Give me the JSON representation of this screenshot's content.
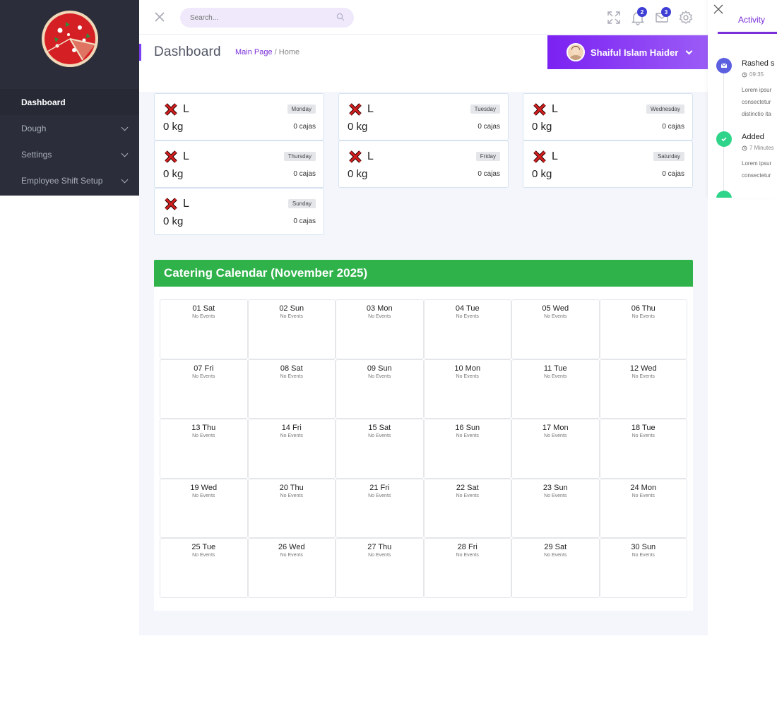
{
  "sidebar": {
    "items": [
      {
        "label": "Dashboard",
        "active": true
      },
      {
        "label": "Dough"
      },
      {
        "label": "Settings"
      },
      {
        "label": "Employee Shift Setup"
      }
    ]
  },
  "topbar": {
    "search_placeholder": "Search...",
    "notifications_count": "2",
    "messages_count": "3"
  },
  "header": {
    "title": "Dashboard",
    "breadcrumb_link": "Main Page",
    "breadcrumb_sep": "/",
    "breadcrumb_current": "Home",
    "user_name": "Shaiful Islam Haider"
  },
  "days": [
    {
      "letter": "L",
      "day": "Monday",
      "kg": "0 kg",
      "cajas": "0 cajas"
    },
    {
      "letter": "L",
      "day": "Tuesday",
      "kg": "0 kg",
      "cajas": "0 cajas"
    },
    {
      "letter": "L",
      "day": "Wednesday",
      "kg": "0 kg",
      "cajas": "0 cajas"
    },
    {
      "letter": "L",
      "day": "Thursday",
      "kg": "0 kg",
      "cajas": "0 cajas"
    },
    {
      "letter": "L",
      "day": "Friday",
      "kg": "0 kg",
      "cajas": "0 cajas"
    },
    {
      "letter": "L",
      "day": "Saturday",
      "kg": "0 kg",
      "cajas": "0 cajas"
    },
    {
      "letter": "L",
      "day": "Sunday",
      "kg": "0 kg",
      "cajas": "0 cajas"
    }
  ],
  "calendar": {
    "title": "Catering Calendar (November 2025)",
    "no_events": "No Events",
    "dates": [
      "01 Sat",
      "02 Sun",
      "03 Mon",
      "04 Tue",
      "05 Wed",
      "06 Thu",
      "07 Fri",
      "08 Sat",
      "09 Sun",
      "10 Mon",
      "11 Tue",
      "12 Wed",
      "13 Thu",
      "14 Fri",
      "15 Sat",
      "16 Sun",
      "17 Mon",
      "18 Tue",
      "19 Wed",
      "20 Thu",
      "21 Fri",
      "22 Sat",
      "23 Sun",
      "24 Mon",
      "25 Tue",
      "26 Wed",
      "27 Thu",
      "28 Fri",
      "29 Sat",
      "30 Sun"
    ]
  },
  "activity": {
    "tab": "Activity",
    "items": [
      {
        "title": "Rashed s",
        "time": "09:35",
        "text": [
          "Lorem ipsur",
          "consectetur",
          "distinctio ita"
        ],
        "color": "#5b5fe0",
        "icon": "envelope-icon"
      },
      {
        "title": "Added",
        "time": "7 Minutes",
        "text": [
          "Lorem ipsur",
          "consectetur"
        ],
        "color": "#2ed48a",
        "icon": "check-icon"
      }
    ]
  },
  "colors": {
    "accent": "#7a2fd9",
    "sidebar_bg": "#2b2e3a",
    "calendar_header": "#2fb24a",
    "badge": "#3f3fd6"
  }
}
